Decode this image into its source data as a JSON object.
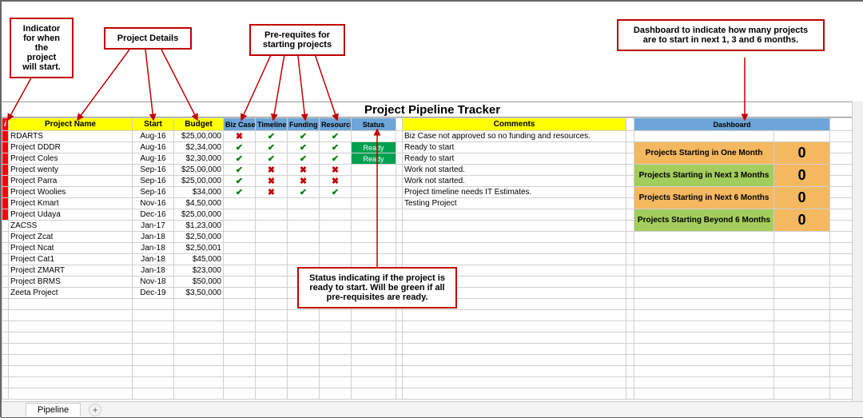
{
  "title": "Project Pipeline Tracker",
  "headers": {
    "indicator": "i",
    "project_name": "Project Name",
    "start": "Start",
    "budget": "Budget",
    "biz_case": "Biz Case",
    "timeline": "Timeline",
    "funding": "Funding",
    "resourcing": "Resourcing",
    "status": "Status",
    "comments": "Comments",
    "dashboard": "Dashboard"
  },
  "rows": [
    {
      "ind": "red",
      "name": "RDARTS",
      "start": "Aug-16",
      "budget": "$25,00,000",
      "bc": "x",
      "tl": "t",
      "fd": "t",
      "rs": "t",
      "status": "",
      "comment": "Biz Case not approved so no funding and resources."
    },
    {
      "ind": "red",
      "name": "Project DDDR",
      "start": "Aug-16",
      "budget": "$2,34,000",
      "bc": "t",
      "tl": "t",
      "fd": "t",
      "rs": "t",
      "status": "Ready",
      "comment": "Ready to start"
    },
    {
      "ind": "red",
      "name": "Project Coles",
      "start": "Aug-16",
      "budget": "$2,30,000",
      "bc": "t",
      "tl": "t",
      "fd": "t",
      "rs": "t",
      "status": "Ready",
      "comment": "Ready to start"
    },
    {
      "ind": "red",
      "name": "Project wenty",
      "start": "Sep-16",
      "budget": "$25,00,000",
      "bc": "t",
      "tl": "x",
      "fd": "x",
      "rs": "x",
      "status": "",
      "comment": "Work not started."
    },
    {
      "ind": "red",
      "name": "Project Parra",
      "start": "Sep-16",
      "budget": "$25,00,000",
      "bc": "t",
      "tl": "x",
      "fd": "x",
      "rs": "x",
      "status": "",
      "comment": "Work not started."
    },
    {
      "ind": "red",
      "name": "Project Woolies",
      "start": "Sep-16",
      "budget": "$34,000",
      "bc": "t",
      "tl": "x",
      "fd": "t",
      "rs": "t",
      "status": "",
      "comment": "Project timeline needs IT Estimates."
    },
    {
      "ind": "red",
      "name": "Project Kmart",
      "start": "Nov-16",
      "budget": "$4,50,000",
      "bc": "",
      "tl": "",
      "fd": "",
      "rs": "",
      "status": "",
      "comment": "Testing Project"
    },
    {
      "ind": "red",
      "name": "Project Udaya",
      "start": "Dec-16",
      "budget": "$25,00,000",
      "bc": "",
      "tl": "",
      "fd": "",
      "rs": "",
      "status": "",
      "comment": ""
    },
    {
      "ind": "",
      "name": "ZACSS",
      "start": "Jan-17",
      "budget": "$1,23,000",
      "bc": "",
      "tl": "",
      "fd": "",
      "rs": "",
      "status": "",
      "comment": ""
    },
    {
      "ind": "",
      "name": "Project Zcat",
      "start": "Jan-18",
      "budget": "$2,50,000",
      "bc": "",
      "tl": "",
      "fd": "",
      "rs": "",
      "status": "",
      "comment": ""
    },
    {
      "ind": "",
      "name": "Project Ncat",
      "start": "Jan-18",
      "budget": "$2,50,001",
      "bc": "",
      "tl": "",
      "fd": "",
      "rs": "",
      "status": "",
      "comment": ""
    },
    {
      "ind": "",
      "name": "Project Cat1",
      "start": "Jan-18",
      "budget": "$45,000",
      "bc": "",
      "tl": "",
      "fd": "",
      "rs": "",
      "status": "",
      "comment": ""
    },
    {
      "ind": "",
      "name": "Project ZMART",
      "start": "Jan-18",
      "budget": "$23,000",
      "bc": "",
      "tl": "",
      "fd": "",
      "rs": "",
      "status": "",
      "comment": ""
    },
    {
      "ind": "",
      "name": "Project BRMS",
      "start": "Nov-18",
      "budget": "$50,000",
      "bc": "",
      "tl": "",
      "fd": "",
      "rs": "",
      "status": "",
      "comment": ""
    },
    {
      "ind": "",
      "name": "Zeeta Project",
      "start": "Dec-19",
      "budget": "$3,50,000",
      "bc": "",
      "tl": "",
      "fd": "",
      "rs": "",
      "status": "",
      "comment": ""
    }
  ],
  "dashboard": [
    {
      "label": "Projects Starting in One Month",
      "value": "0",
      "cls": "dash-orange"
    },
    {
      "label": "Projects Starting in Next 3 Months",
      "value": "0",
      "cls": "dash-green"
    },
    {
      "label": "Projects Starting in Next 6 Months",
      "value": "0",
      "cls": "dash-orange"
    },
    {
      "label": "Projects Starting Beyond 6 Months",
      "value": "0",
      "cls": "dash-green"
    }
  ],
  "callouts": {
    "c1": "Indicator for when the project will start.",
    "c2": "Project Details",
    "c3": "Pre-requites for starting projects",
    "c4": "Dashboard to indicate how many projects are to start in next 1, 3 and 6 months.",
    "c5": "Status indicating if the project is ready to start. Will be green if all pre-requisites are ready."
  },
  "sheet_tab": "Pipeline"
}
